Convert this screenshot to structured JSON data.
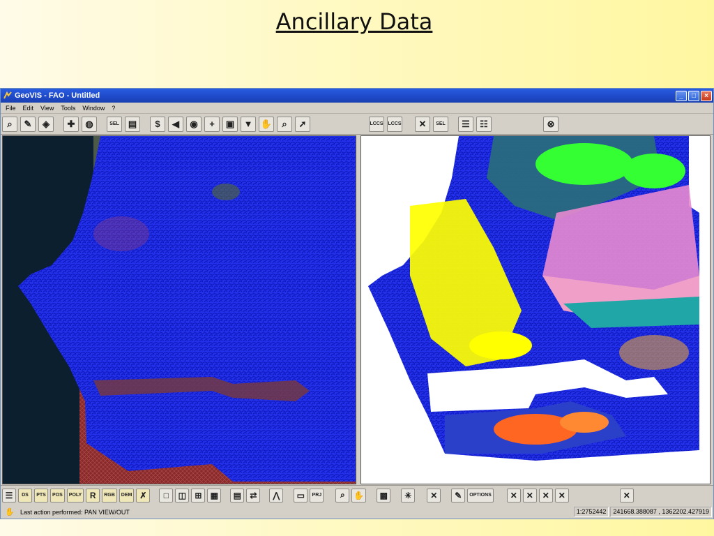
{
  "slide": {
    "title": "Ancillary Data"
  },
  "window": {
    "title": "GeoVIS - FAO - Untitled",
    "controls": {
      "minimize": "_",
      "maximize": "□",
      "close": "×"
    }
  },
  "menu": [
    "File",
    "Edit",
    "View",
    "Tools",
    "Window",
    "?"
  ],
  "toolbar": {
    "buttons": [
      {
        "name": "zoom-layer-icon",
        "glyph": "⌕"
      },
      {
        "name": "pencil-icon",
        "glyph": "✎"
      },
      {
        "name": "polygon-edit-icon",
        "glyph": "◈"
      },
      {
        "name": "add-layer-icon",
        "glyph": "✚"
      },
      {
        "name": "globe-layer-icon",
        "glyph": "◍"
      },
      {
        "name": "select-icon",
        "glyph": "SEL"
      },
      {
        "name": "layer-properties-icon",
        "glyph": "▤"
      },
      {
        "name": "dollar-globe-icon",
        "glyph": "$"
      },
      {
        "name": "pan-left-icon",
        "glyph": "◀"
      },
      {
        "name": "globe-icon",
        "glyph": "◉"
      },
      {
        "name": "zoom-in-icon",
        "glyph": "+"
      },
      {
        "name": "map-page-icon",
        "glyph": "▣"
      },
      {
        "name": "pan-down-icon",
        "glyph": "▼"
      },
      {
        "name": "pan-hand-icon",
        "glyph": "✋"
      },
      {
        "name": "magnifier-icon",
        "glyph": "⌕"
      },
      {
        "name": "arrow-pointer-icon",
        "glyph": "➚"
      },
      {
        "name": "lccs-icon-1",
        "glyph": "LCCS"
      },
      {
        "name": "lccs-icon-2",
        "glyph": "LCCS"
      },
      {
        "name": "delete-x-icon",
        "glyph": "✕"
      },
      {
        "name": "selection-table-icon",
        "glyph": "SEL"
      },
      {
        "name": "table-view-icon",
        "glyph": "☰"
      },
      {
        "name": "table-edit-icon",
        "glyph": "☷"
      },
      {
        "name": "exit-icon",
        "glyph": "⊗"
      }
    ]
  },
  "bottom_toolbar": {
    "buttons": [
      {
        "name": "layers-list-icon",
        "label": "☰"
      },
      {
        "name": "open-ds-icon",
        "label": "DS"
      },
      {
        "name": "open-pts-icon",
        "label": "PTS"
      },
      {
        "name": "open-pos-icon",
        "label": "POS"
      },
      {
        "name": "open-poly-icon",
        "label": "POLY"
      },
      {
        "name": "open-r-icon",
        "label": "R"
      },
      {
        "name": "open-rgb-icon",
        "label": "RGB"
      },
      {
        "name": "open-dem-icon",
        "label": "DEM"
      },
      {
        "name": "remove-layer-icon",
        "label": "✗"
      },
      {
        "name": "single-view-icon",
        "label": "□"
      },
      {
        "name": "dual-view-icon",
        "label": "◫"
      },
      {
        "name": "quad-view-icon",
        "label": "⊞"
      },
      {
        "name": "color-view-icon",
        "label": "▦"
      },
      {
        "name": "notes-icon",
        "label": "▤"
      },
      {
        "name": "sync-icon",
        "label": "⇄"
      },
      {
        "name": "profile-icon",
        "label": "⋀"
      },
      {
        "name": "save-icon",
        "label": "▭"
      },
      {
        "name": "save-prj-icon",
        "label": "PRJ"
      },
      {
        "name": "search-icon",
        "label": "⌕"
      },
      {
        "name": "hand-icon",
        "label": "✋"
      },
      {
        "name": "picture-icon",
        "label": "▩"
      },
      {
        "name": "measure-icon",
        "label": "✳"
      },
      {
        "name": "cancel-icon",
        "label": "✕"
      },
      {
        "name": "edit-icon",
        "label": "✎"
      },
      {
        "name": "options-icon",
        "label": "OPTIONS"
      },
      {
        "name": "close-layer-1-icon",
        "label": "✕"
      },
      {
        "name": "close-layer-2-icon",
        "label": "✕"
      },
      {
        "name": "close-layer-3-icon",
        "label": "✕"
      },
      {
        "name": "close-layer-4-icon",
        "label": "✕"
      },
      {
        "name": "green-x-icon",
        "label": "✕"
      }
    ]
  },
  "status": {
    "message": "Last action performed: PAN VIEW/OUT",
    "scale": "1:2752442",
    "coordinates": "241668.388087 , 1362202.427919"
  },
  "colors": {
    "boundary": "#1a1aff",
    "land_red": "#a0322a",
    "yellow_class": "#ffff00",
    "green_class": "#33ff33",
    "pink_class": "#f0a0c8",
    "teal_class": "#20a6a6",
    "orange_class": "#ff6622"
  }
}
